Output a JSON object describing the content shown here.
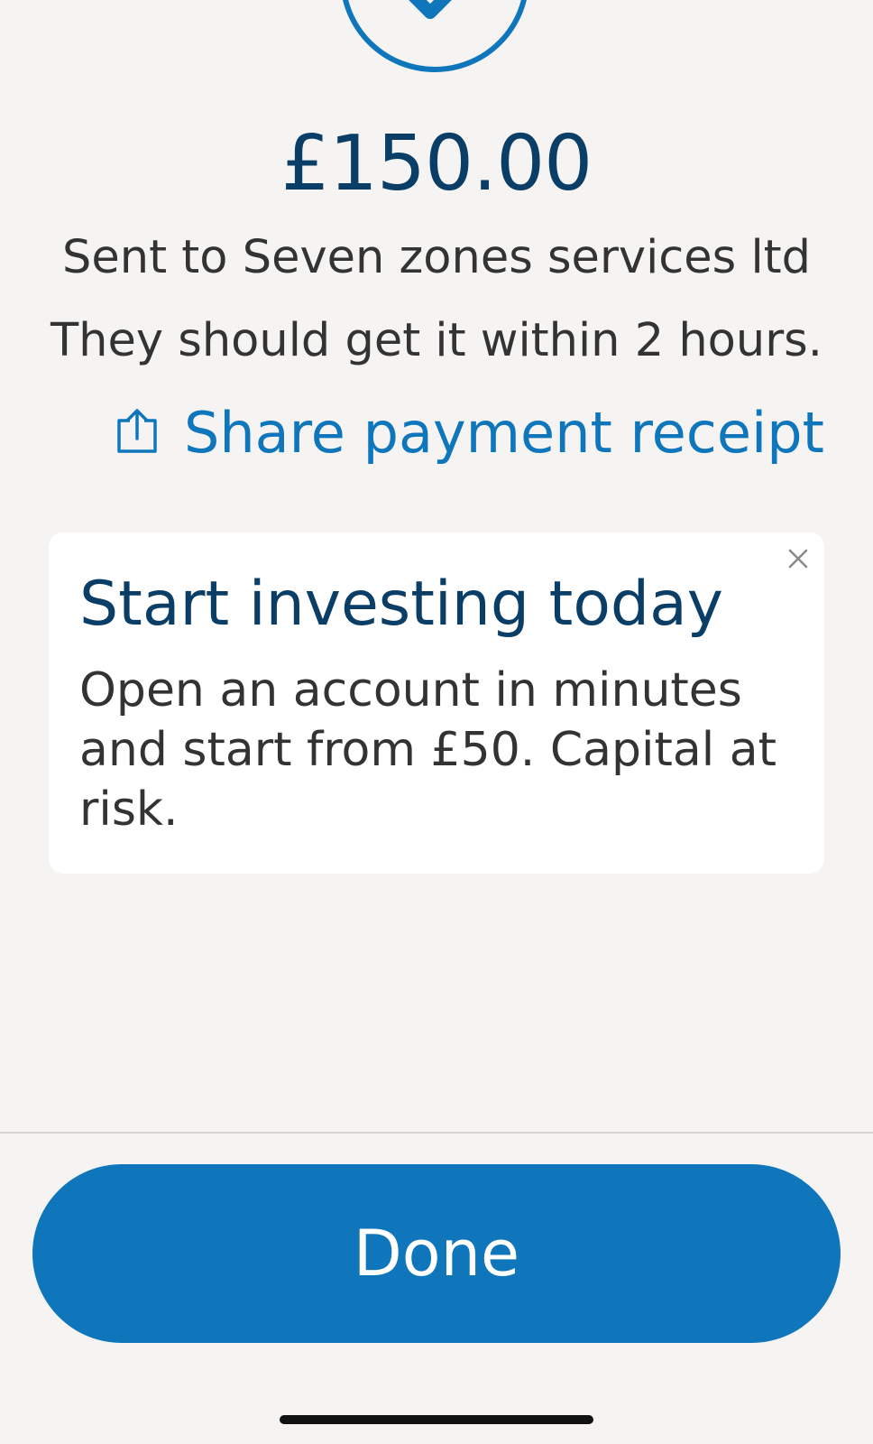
{
  "confirmation": {
    "status_icon": "checkmark-circle-icon",
    "amount": "£150.00",
    "sent_to": "Sent to Seven zones services ltd",
    "timing": "They should get it within 2 hours."
  },
  "share": {
    "icon": "share-icon",
    "label": "Share payment receipt"
  },
  "promo": {
    "title": "Start investing today",
    "body": "Open an account in minutes and start from £50. Capital at risk.",
    "close_icon": "close-icon"
  },
  "footer": {
    "done_label": "Done"
  },
  "colors": {
    "accent": "#0f76bb",
    "heading": "#0b3e66",
    "body_text": "#333333",
    "background": "#f5f4f2",
    "card": "#ffffff"
  }
}
